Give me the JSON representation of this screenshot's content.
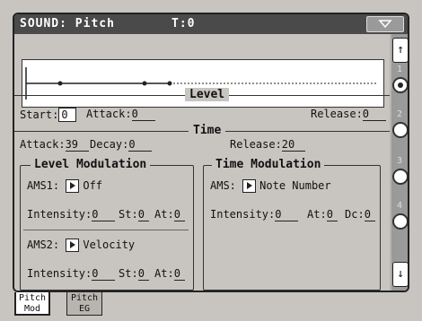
{
  "title": {
    "mode": "SOUND: Pitch",
    "tempo": "T:0"
  },
  "level_label": "Level",
  "time_label": "Time",
  "level": {
    "start_label": "Start:",
    "start_value": "0",
    "attack_label": "Attack:",
    "attack_value": "0",
    "release_label": "Release:",
    "release_value": "0"
  },
  "time": {
    "attack_label": "Attack:",
    "attack_value": "39",
    "decay_label": "Decay:",
    "decay_value": "0",
    "release_label": "Release:",
    "release_value": "20"
  },
  "level_mod": {
    "title": "Level Modulation",
    "ams1_label": "AMS1:",
    "ams1_value": "Off",
    "int1_label": "Intensity:",
    "int1_value": "0",
    "st1_label": "St:",
    "st1_value": "0",
    "at1_label": "At:",
    "at1_value": "0",
    "ams2_label": "AMS2:",
    "ams2_value": "Velocity",
    "int2_label": "Intensity:",
    "int2_value": "0",
    "st2_label": "St:",
    "st2_value": "0",
    "at2_label": "At:",
    "at2_value": "0"
  },
  "time_mod": {
    "title": "Time Modulation",
    "ams_label": "AMS:",
    "ams_value": "Note Number",
    "int_label": "Intensity:",
    "int_value": "0",
    "at_label": "At:",
    "at_value": "0",
    "dc_label": "Dc:",
    "dc_value": "0"
  },
  "sidebar": {
    "numbers": [
      "1",
      "2",
      "3",
      "4"
    ],
    "selected_index": 0
  },
  "tabs": [
    {
      "line1": "Pitch",
      "line2": "Mod",
      "active": true
    },
    {
      "line1": "Pitch",
      "line2": "EG",
      "active": false
    }
  ],
  "icons": {
    "menu": "dropdown-triangle-icon",
    "up": "arrow-up-icon",
    "down": "arrow-down-icon"
  }
}
